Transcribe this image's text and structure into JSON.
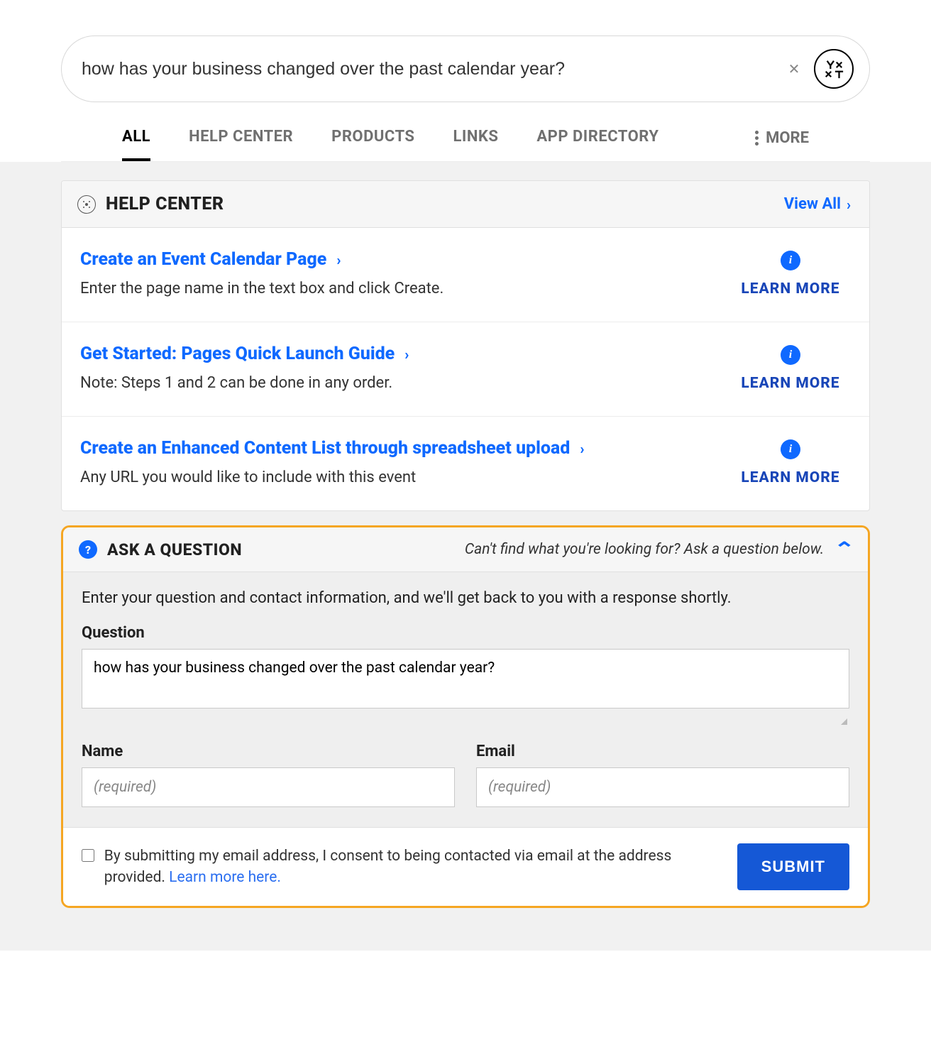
{
  "search": {
    "value": "how has your business changed over the past calendar year?"
  },
  "tabs": {
    "items": [
      "ALL",
      "HELP CENTER",
      "PRODUCTS",
      "LINKS",
      "APP DIRECTORY"
    ],
    "more": "MORE",
    "active_index": 0
  },
  "help_center": {
    "header": "HELP CENTER",
    "view_all": "View All",
    "learn_more": "LEARN MORE",
    "results": [
      {
        "title": "Create an Event Calendar Page",
        "desc": "Enter the page name in the text box and click Create."
      },
      {
        "title": "Get Started: Pages Quick Launch Guide",
        "desc": "Note: Steps 1 and 2 can be done in any order."
      },
      {
        "title": "Create an Enhanced Content List through spreadsheet upload",
        "desc": "Any URL you would like to include with this event"
      }
    ]
  },
  "ask": {
    "header": "ASK A QUESTION",
    "hint": "Can't find what you're looking for? Ask a question below.",
    "intro": "Enter your question and contact information, and we'll get back to you with a response shortly.",
    "question_label": "Question",
    "question_value": "how has your business changed over the past calendar year?",
    "name_label": "Name",
    "name_placeholder": "(required)",
    "email_label": "Email",
    "email_placeholder": "(required)",
    "consent_text": "By submitting my email address, I consent to being contacted via email at the address provided. ",
    "consent_link": "Learn more here.",
    "submit": "SUBMIT"
  }
}
